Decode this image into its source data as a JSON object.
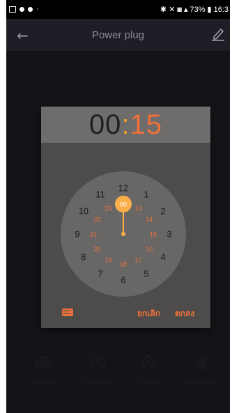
{
  "status_bar": {
    "time": "16:3",
    "battery": "73%"
  },
  "app_bar": {
    "title": "Power plug"
  },
  "picker": {
    "hours": "00",
    "separator": ":",
    "minutes": "15",
    "outer_numbers": [
      "12",
      "1",
      "2",
      "3",
      "4",
      "5",
      "6",
      "7",
      "8",
      "9",
      "10",
      "11"
    ],
    "inner_numbers": [
      "00",
      "13",
      "14",
      "15",
      "16",
      "17",
      "18",
      "19",
      "20",
      "21",
      "22",
      "23"
    ],
    "selected": "00",
    "cancel_label": "ยกเลิก",
    "ok_label": "ตกลง"
  },
  "bottom_nav": {
    "items": [
      {
        "label": "Switch",
        "icon": "switch-icon"
      },
      {
        "label": "Schedule",
        "icon": "clock-icon"
      },
      {
        "label": "Timer",
        "icon": "timer-icon"
      },
      {
        "label": "Statistics",
        "icon": "statistics-icon"
      }
    ]
  },
  "colors": {
    "accent": "#f0703a",
    "selector": "#f9b04a",
    "dialog": "#4d4c4b",
    "header": "#6e6d6c",
    "dial": "#686766"
  }
}
